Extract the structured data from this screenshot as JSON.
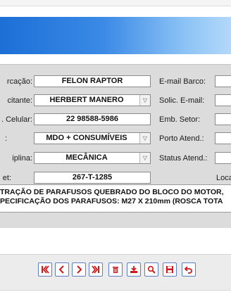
{
  "form": {
    "embarcacao_label": "rcação:",
    "embarcacao_value": "FELON RAPTOR",
    "solicitante_label": "citante:",
    "solicitante_value": "HERBERT MANERO",
    "celular_label": ". Celular:",
    "celular_value": "22 98588-5986",
    "tipo_label": ":",
    "tipo_value": "MDO + CONSUMÍVEIS",
    "disciplina_label": "iplina:",
    "disciplina_value": "MECÂNICA",
    "ticket_label": "et:",
    "ticket_value": "267-T-1285"
  },
  "right": {
    "email_barco_label": "E-mail Barco:",
    "solic_email_label": "Solic. E-mail:",
    "emb_setor_label": "Emb. Setor:",
    "porto_label": "Porto Atend.:",
    "status_label": "Status Atend.:",
    "local_label": "Loca"
  },
  "description": {
    "line1": "TRAÇÃO DE PARAFUSOS QUEBRADO DO BLOCO DO MOTOR,",
    "line2": "PECIFICAÇÃO DOS PARAFUSOS: M27 X 210mm (ROSCA TOTA"
  },
  "toolbar": {
    "buttons": [
      "first-record",
      "previous-record",
      "next-record",
      "last-record",
      "delete",
      "export",
      "search",
      "save",
      "undo"
    ]
  },
  "colors": {
    "banner_start": "#1c6fd6",
    "banner_end": "#b4d8fa",
    "panel_bg": "#dcdcdc",
    "toolbar_icon_red": "#d01818"
  }
}
